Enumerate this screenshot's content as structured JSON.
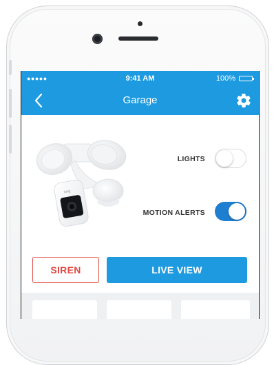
{
  "status_bar": {
    "signal": "●●●●●",
    "time": "9:41 AM",
    "battery": "100%"
  },
  "nav": {
    "title": "Garage",
    "back_icon": "chevron-left-icon",
    "settings_icon": "gear-icon"
  },
  "device": {
    "brand_mark": "ring"
  },
  "controls": {
    "lights": {
      "label": "LIGHTS",
      "on": false
    },
    "motion_alerts": {
      "label": "MOTION ALERTS",
      "on": true
    }
  },
  "actions": {
    "siren_label": "SIREN",
    "live_view_label": "LIVE VIEW"
  },
  "colors": {
    "brand_blue": "#1e9be0",
    "toggle_on": "#1e7fd1",
    "siren_red": "#e04b46"
  }
}
